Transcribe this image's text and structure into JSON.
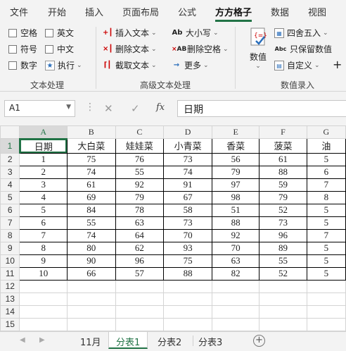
{
  "menu_tabs": [
    "文件",
    "开始",
    "插入",
    "页面布局",
    "公式",
    "方方格子",
    "数据",
    "视图"
  ],
  "active_tab": "方方格子",
  "ribbon": {
    "text_group": {
      "checkboxes": [
        "空格",
        "英文",
        "符号",
        "中文",
        "数字"
      ],
      "execute": "执行",
      "label": "文本处理"
    },
    "advanced_group": {
      "insert_text": "插入文本",
      "delete_text": "删除文本",
      "extract_text": "截取文本",
      "case": "大小写",
      "delete_spaces": "删除空格",
      "more": "更多",
      "label": "高级文本处理"
    },
    "numeric_group": {
      "numeric": "数值",
      "round": "四舍五入",
      "keep_value": "只保留数值",
      "custom": "自定义",
      "label": "数值录入"
    }
  },
  "formula_bar": {
    "name_box": "A1",
    "cancel": "✕",
    "confirm": "✓",
    "fx": "fx",
    "content": "日期"
  },
  "sheet": {
    "columns": [
      "A",
      "B",
      "C",
      "D",
      "E",
      "F",
      "G"
    ],
    "headers": [
      "日期",
      "大白菜",
      "娃娃菜",
      "小青菜",
      "香菜",
      "菠菜",
      "油"
    ],
    "rows": [
      [
        "1",
        "75",
        "76",
        "73",
        "56",
        "61",
        "5"
      ],
      [
        "2",
        "74",
        "55",
        "74",
        "79",
        "88",
        "6"
      ],
      [
        "3",
        "61",
        "92",
        "91",
        "97",
        "59",
        "7"
      ],
      [
        "4",
        "69",
        "79",
        "67",
        "98",
        "79",
        "8"
      ],
      [
        "5",
        "84",
        "78",
        "58",
        "51",
        "52",
        "5"
      ],
      [
        "6",
        "55",
        "63",
        "73",
        "88",
        "73",
        "5"
      ],
      [
        "7",
        "74",
        "64",
        "70",
        "92",
        "96",
        "7"
      ],
      [
        "8",
        "80",
        "62",
        "93",
        "70",
        "89",
        "5"
      ],
      [
        "9",
        "90",
        "96",
        "75",
        "63",
        "55",
        "5"
      ],
      [
        "10",
        "66",
        "57",
        "88",
        "82",
        "52",
        "5"
      ]
    ],
    "row_numbers": [
      "1",
      "2",
      "3",
      "4",
      "5",
      "6",
      "7",
      "8",
      "9",
      "10",
      "11",
      "12",
      "13",
      "14",
      "15"
    ],
    "active_cell": "A1"
  },
  "sheet_tabs": [
    "11月",
    "分表1",
    "分表2",
    "分表3"
  ],
  "active_sheet": "分表1",
  "colors": {
    "accent": "#217346",
    "ribbon_bg": "#f3f3f3"
  }
}
